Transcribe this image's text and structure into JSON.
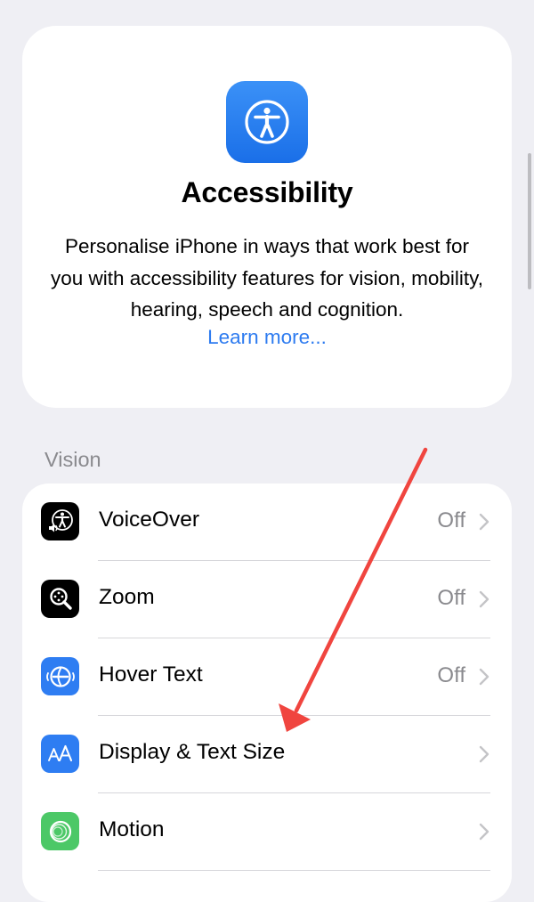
{
  "header": {
    "title": "Accessibility",
    "description": "Personalise iPhone in ways that work best for you with accessibility features for vision, mobility, hearing, speech and cognition.",
    "link": "Learn more..."
  },
  "vision": {
    "section_title": "Vision",
    "items": [
      {
        "label": "VoiceOver",
        "value": "Off",
        "icon": "voiceover-icon"
      },
      {
        "label": "Zoom",
        "value": "Off",
        "icon": "zoom-icon"
      },
      {
        "label": "Hover Text",
        "value": "Off",
        "icon": "hover-text-icon"
      },
      {
        "label": "Display & Text Size",
        "value": "",
        "icon": "display-text-size-icon"
      },
      {
        "label": "Motion",
        "value": "",
        "icon": "motion-icon"
      }
    ]
  },
  "colors": {
    "accent": "#2d7bf0",
    "annotation_arrow": "#f0453f",
    "background": "#efeff4"
  }
}
